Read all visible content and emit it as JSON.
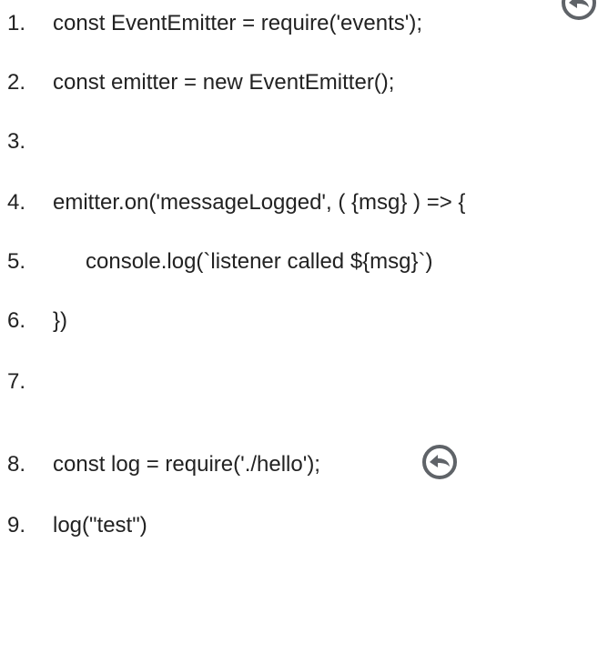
{
  "code_block": {
    "lines": [
      {
        "number": "1.",
        "text": "const EventEmitter = require('events');"
      },
      {
        "number": "2.",
        "text": "const emitter = new EventEmitter();"
      },
      {
        "number": "3.",
        "text": ""
      },
      {
        "number": "4.",
        "text": "emitter.on('messageLogged', ( {msg} ) => {"
      },
      {
        "number": "5.",
        "text": "console.log(`listener called ${msg}`)"
      },
      {
        "number": "6.",
        "text": "})"
      },
      {
        "number": "7.",
        "text": ""
      },
      {
        "number": "8.",
        "text": "const log = require('./hello');"
      },
      {
        "number": "9.",
        "text": "log(\"test\")"
      }
    ]
  },
  "icons": {
    "top_cursor": "undo-arrow-icon",
    "bottom_cursor": "undo-arrow-icon",
    "icon_color": "#5f6368"
  }
}
